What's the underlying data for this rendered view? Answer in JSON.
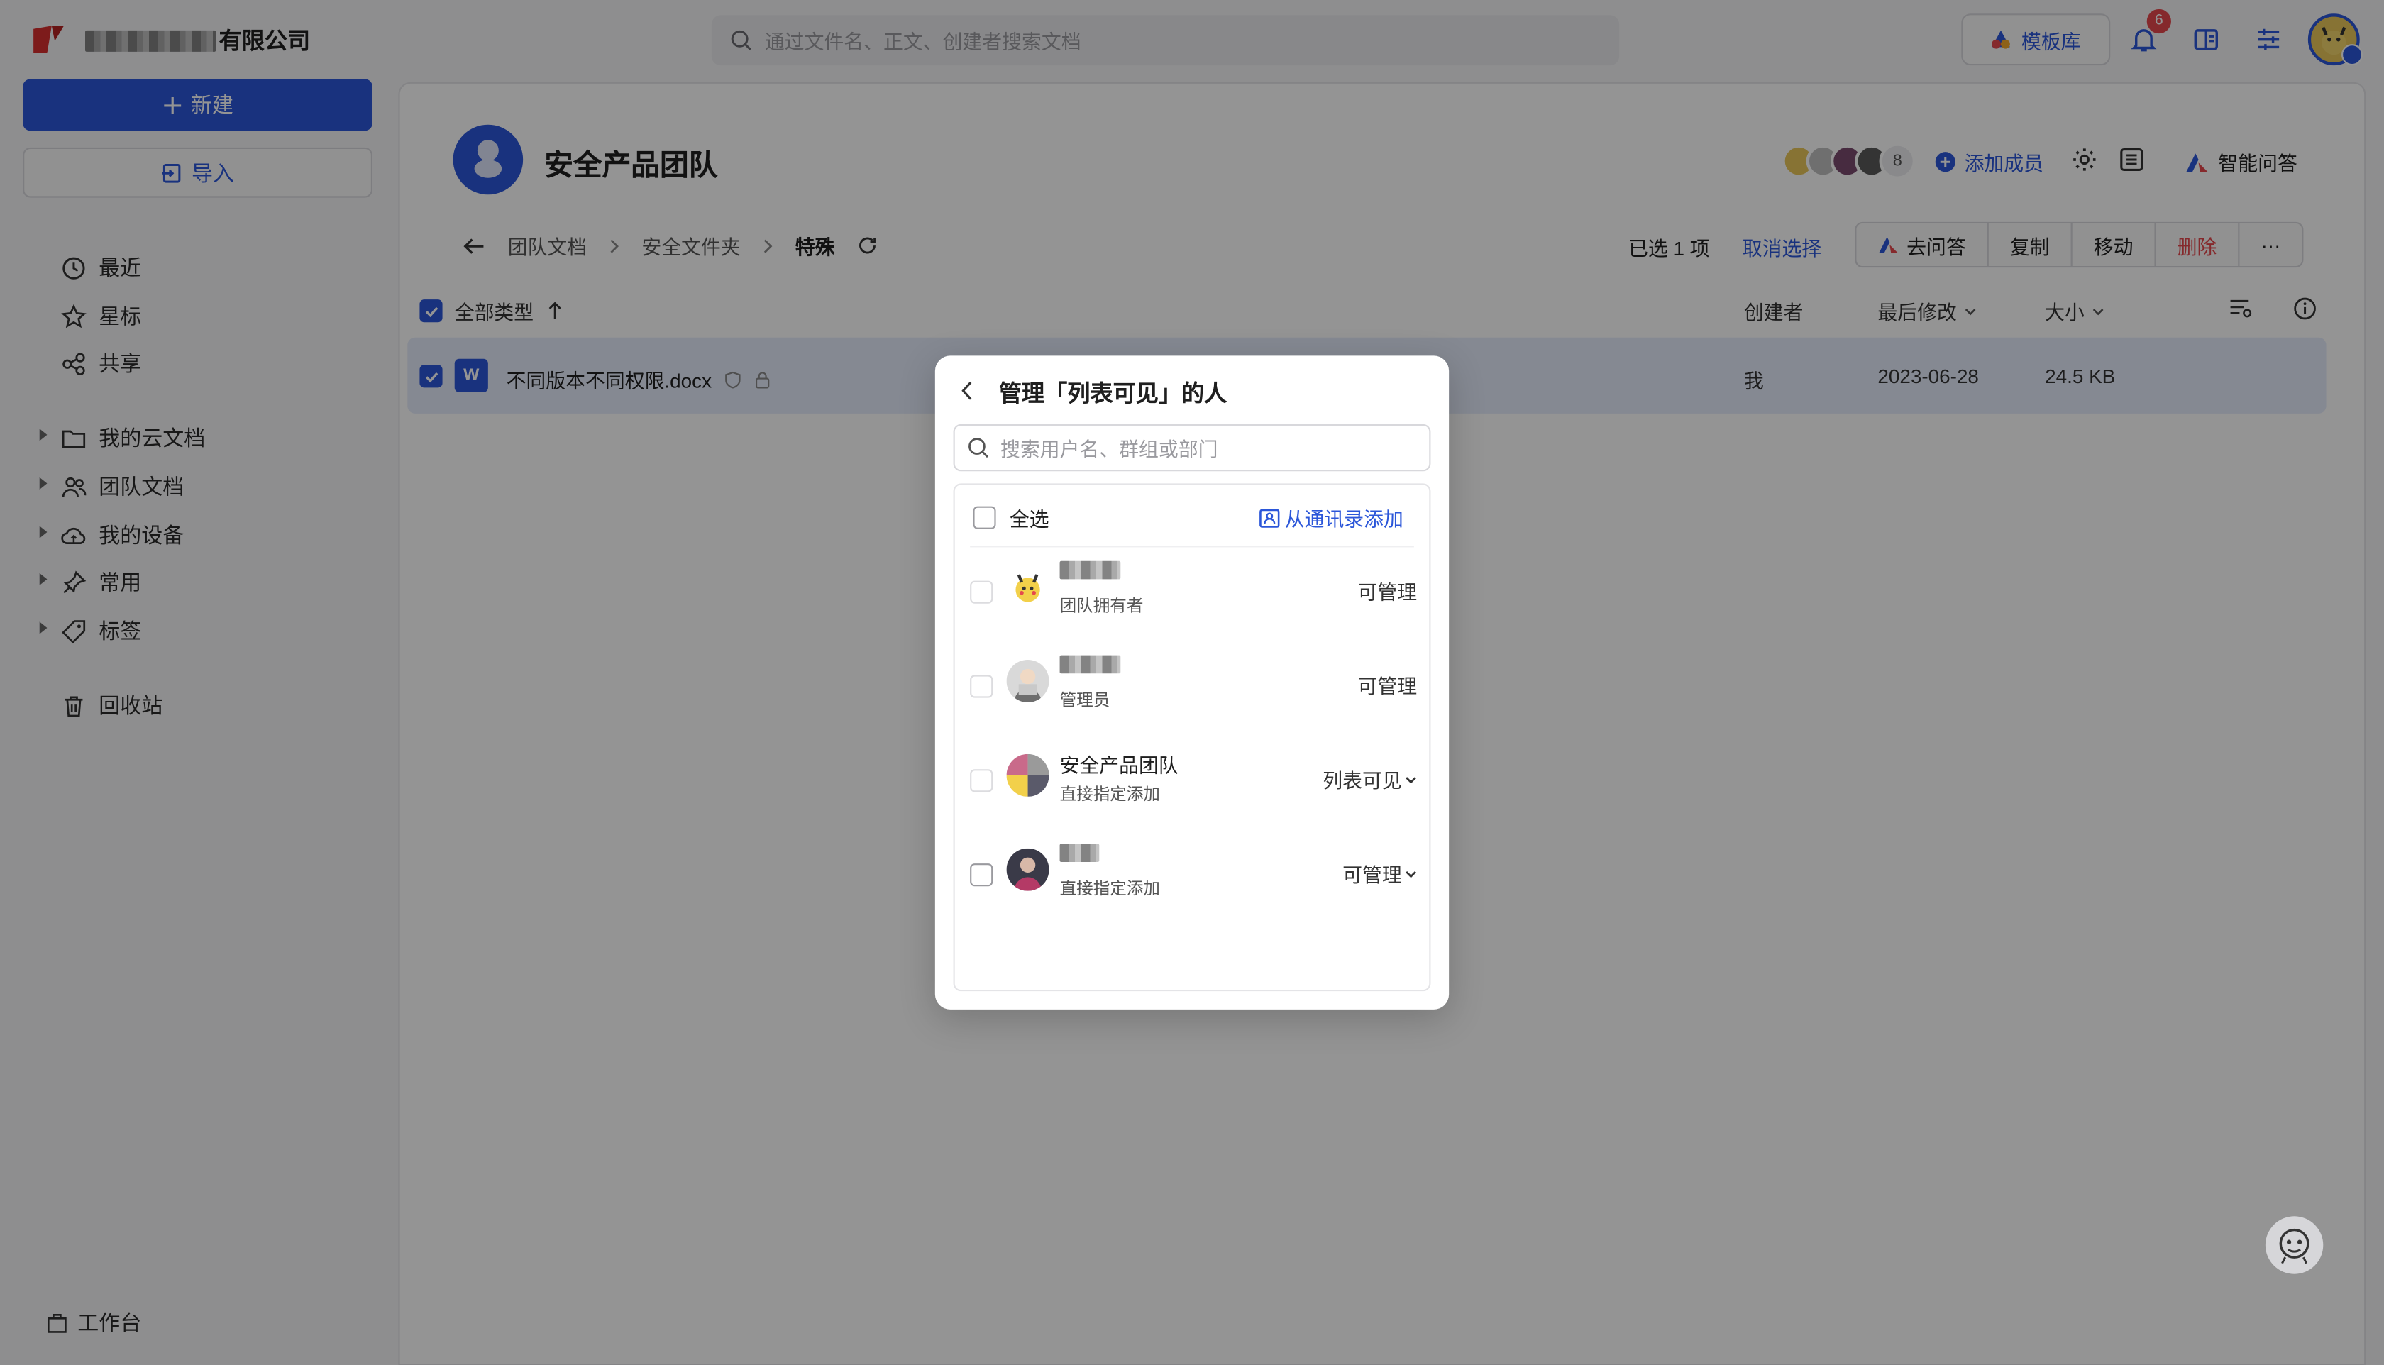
{
  "colors": {
    "accent": "#2b56d9",
    "danger": "#e5484d",
    "logo": "#d83030"
  },
  "topbar": {
    "company_suffix": "有限公司",
    "search_placeholder": "通过文件名、正文、创建者搜索文档",
    "template_lib": "模板库",
    "notification_count": "6",
    "icons": [
      "bell-icon",
      "split-view-icon",
      "sliders-icon"
    ]
  },
  "sidebar": {
    "new_button": "新建",
    "import_button": "导入",
    "quick": [
      {
        "label": "最近",
        "icon": "clock-icon"
      },
      {
        "label": "星标",
        "icon": "star-icon"
      },
      {
        "label": "共享",
        "icon": "share-icon"
      }
    ],
    "trees": [
      {
        "label": "我的云文档",
        "icon": "folder-icon"
      },
      {
        "label": "团队文档",
        "icon": "team-icon"
      },
      {
        "label": "我的设备",
        "icon": "cloud-icon"
      },
      {
        "label": "常用",
        "icon": "pin-icon"
      },
      {
        "label": "标签",
        "icon": "tag-icon"
      }
    ],
    "trash": "回收站",
    "workbench": "工作台"
  },
  "team": {
    "name": "安全产品团队",
    "member_count": "8",
    "add_member": "添加成员",
    "smart_qa": "智能问答"
  },
  "breadcrumb": {
    "items": [
      "团队文档",
      "安全文件夹"
    ],
    "current": "特殊"
  },
  "selection": {
    "info": "已选 1 项",
    "cancel": "取消选择",
    "actions": {
      "ask": "去问答",
      "copy": "复制",
      "move": "移动",
      "delete": "删除",
      "more": "···"
    }
  },
  "table": {
    "headers": {
      "type": "全部类型",
      "creator": "创建者",
      "modified": "最后修改",
      "size": "大小"
    },
    "rows": [
      {
        "name": "不同版本不同权限.docx",
        "creator": "我",
        "modified": "2023-06-28",
        "size": "24.5 KB",
        "icon_letter": "W"
      }
    ]
  },
  "modal": {
    "title": "管理「列表可见」的人",
    "search_placeholder": "搜索用户名、群组或部门",
    "select_all": "全选",
    "from_contacts": "从通讯录添加",
    "people": [
      {
        "name": "",
        "role": "团队拥有者",
        "permission": "可管理",
        "dropdown": false
      },
      {
        "name": "",
        "role": "管理员",
        "permission": "可管理",
        "dropdown": false
      },
      {
        "name": "安全产品团队",
        "role": "直接指定添加",
        "permission": "列表可见",
        "dropdown": true
      },
      {
        "name": "",
        "role": "直接指定添加",
        "permission": "可管理",
        "dropdown": true
      }
    ]
  }
}
